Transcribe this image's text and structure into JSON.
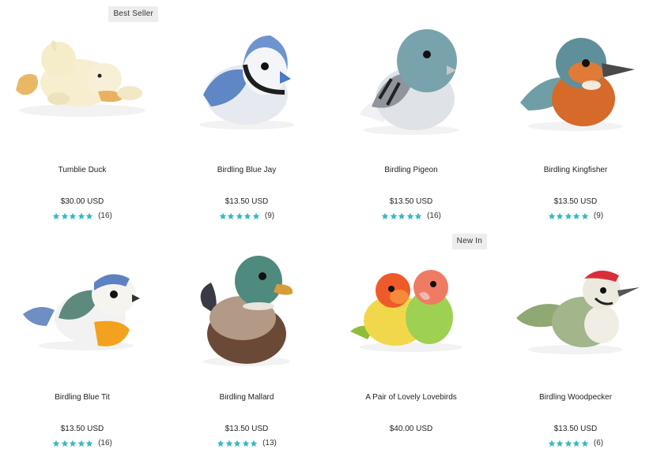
{
  "products": [
    {
      "name": "Tumblie Duck",
      "price": "$30.00 USD",
      "rating_stars": 5,
      "reviews": "(16)",
      "badge": "Best Seller",
      "image": "tumblie-duck-plush"
    },
    {
      "name": "Birdling Blue Jay",
      "price": "$13.50 USD",
      "rating_stars": 5,
      "reviews": "(9)",
      "badge": "",
      "image": "blue-jay-plush"
    },
    {
      "name": "Birdling Pigeon",
      "price": "$13.50 USD",
      "rating_stars": 5,
      "reviews": "(16)",
      "badge": "",
      "image": "pigeon-plush"
    },
    {
      "name": "Birdling Kingfisher",
      "price": "$13.50 USD",
      "rating_stars": 5,
      "reviews": "(9)",
      "badge": "",
      "image": "kingfisher-plush"
    },
    {
      "name": "Birdling Blue Tit",
      "price": "$13.50 USD",
      "rating_stars": 5,
      "reviews": "(16)",
      "badge": "",
      "image": "blue-tit-plush"
    },
    {
      "name": "Birdling Mallard",
      "price": "$13.50 USD",
      "rating_stars": 5,
      "reviews": "(13)",
      "badge": "",
      "image": "mallard-plush"
    },
    {
      "name": "A Pair of Lovely Lovebirds",
      "price": "$40.00 USD",
      "rating_stars": 0,
      "reviews": "",
      "badge": "New In",
      "image": "lovebirds-plush"
    },
    {
      "name": "Birdling Woodpecker",
      "price": "$13.50 USD",
      "rating_stars": 5,
      "reviews": "(6)",
      "badge": "",
      "image": "woodpecker-plush"
    }
  ],
  "colors": {
    "star": "#3ab8c4",
    "badge_bg": "#ededed"
  }
}
